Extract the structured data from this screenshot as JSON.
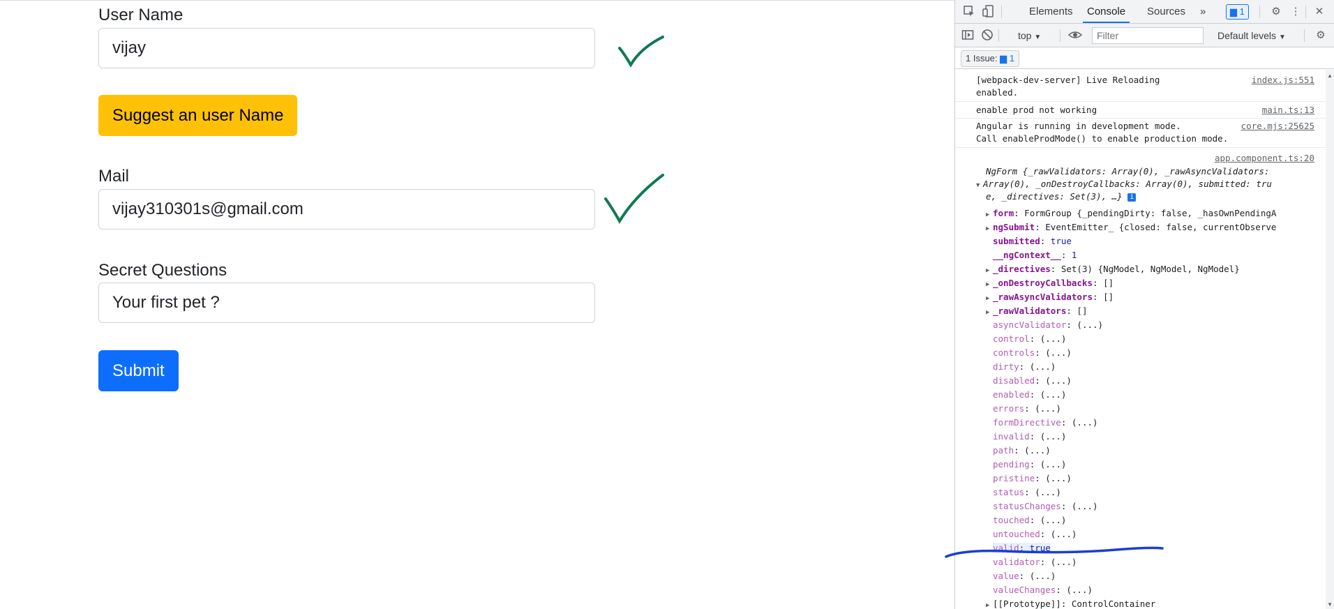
{
  "form": {
    "username_label": "User Name",
    "username_value": "vijay",
    "suggest_button": "Suggest an user Name",
    "mail_label": "Mail",
    "mail_value": "vijay310301s@gmail.com",
    "secret_label": "Secret Questions",
    "secret_value": "Your first pet ?",
    "submit_button": "Submit"
  },
  "devtools": {
    "tabs": [
      "Elements",
      "Console",
      "Sources"
    ],
    "active_tab": "Console",
    "more": "»",
    "issues_badge": "1",
    "context": "top",
    "filter_placeholder": "Filter",
    "levels": "Default levels",
    "issues_label": "1 Issue:",
    "issues_count": "1",
    "messages": [
      {
        "text": "[webpack-dev-server] Live Reloading\nenabled.",
        "source": "index.js:551"
      },
      {
        "text": "enable prod not working",
        "source": "main.ts:13"
      },
      {
        "text": "Angular is running in development mode.\nCall enableProdMode() to enable production mode.",
        "source": "core.mjs:25625"
      }
    ],
    "log_source": "app.component.ts:20",
    "object_summary_1": "NgForm {_rawValidators: Array(0), _rawAsyncValidators:",
    "object_summary_2": "Array(0), _onDestroyCallbacks: Array(0), submitted: tru",
    "object_summary_3": "e, _directives: Set(3), …}",
    "own_props": [
      {
        "key": "form",
        "value": "FormGroup {_pendingDirty: false, _hasOwnPendingA",
        "expandable": true
      },
      {
        "key": "ngSubmit",
        "value": "EventEmitter_ {closed: false, currentObserve",
        "expandable": true
      },
      {
        "key": "submitted",
        "value": "true",
        "expandable": false
      },
      {
        "key": "__ngContext__",
        "value": "1",
        "expandable": false
      },
      {
        "key": "_directives",
        "value": "Set(3) {NgModel, NgModel, NgModel}",
        "expandable": true
      },
      {
        "key": "_onDestroyCallbacks",
        "value": "[]",
        "expandable": true
      },
      {
        "key": "_rawAsyncValidators",
        "value": "[]",
        "expandable": true
      },
      {
        "key": "_rawValidators",
        "value": "[]",
        "expandable": true
      }
    ],
    "accessors": [
      {
        "key": "asyncValidator",
        "value": "(...)"
      },
      {
        "key": "control",
        "value": "(...)"
      },
      {
        "key": "controls",
        "value": "(...)"
      },
      {
        "key": "dirty",
        "value": "(...)"
      },
      {
        "key": "disabled",
        "value": "(...)"
      },
      {
        "key": "enabled",
        "value": "(...)"
      },
      {
        "key": "errors",
        "value": "(...)"
      },
      {
        "key": "formDirective",
        "value": "(...)"
      },
      {
        "key": "invalid",
        "value": "(...)"
      },
      {
        "key": "path",
        "value": "(...)"
      },
      {
        "key": "pending",
        "value": "(...)"
      },
      {
        "key": "pristine",
        "value": "(...)"
      },
      {
        "key": "status",
        "value": "(...)"
      },
      {
        "key": "statusChanges",
        "value": "(...)"
      },
      {
        "key": "touched",
        "value": "(...)"
      },
      {
        "key": "untouched",
        "value": "(...)"
      },
      {
        "key": "valid",
        "value": "true"
      },
      {
        "key": "validator",
        "value": "(...)"
      },
      {
        "key": "value",
        "value": "(...)"
      },
      {
        "key": "valueChanges",
        "value": "(...)"
      }
    ],
    "prototype": {
      "key": "[[Prototype]]",
      "value": "ControlContainer"
    }
  },
  "colors": {
    "check": "#0e7a4f",
    "annotation": "#1a3fd0",
    "warning_button": "#ffc107",
    "primary_button": "#0d6efd",
    "active_tab_underline": "#1a73e8"
  }
}
